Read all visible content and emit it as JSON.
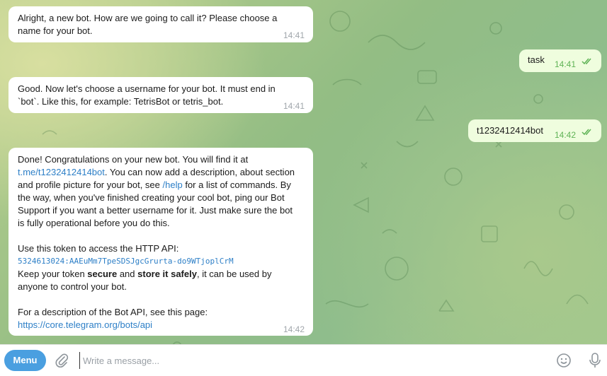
{
  "messages": [
    {
      "direction": "incoming",
      "lines": [
        "Alright, a new bot. How are we going to call it? Please choose a",
        "name for your bot."
      ],
      "time": "14:41"
    },
    {
      "direction": "outgoing",
      "text": "task",
      "time": "14:41",
      "status": "read"
    },
    {
      "direction": "incoming",
      "lines": [
        "Good. Now let's choose a username for your bot. It must end in",
        "`bot`. Like this, for example: TetrisBot or tetris_bot."
      ],
      "time": "14:41"
    },
    {
      "direction": "outgoing",
      "text": "t1232412414bot",
      "time": "14:42",
      "status": "read"
    },
    {
      "direction": "incoming",
      "time": "14:42",
      "parts": {
        "l1": "Done! Congratulations on your new bot. You will find it at",
        "bot_link": "t.me/t1232412414bot",
        "l2_rest": ". You can now add a description, about section",
        "l3_a": "and profile picture for your bot, see ",
        "help_link": "/help",
        "l3_b": " for a list of commands. By",
        "l4": "the way, when you've finished creating your cool bot, ping our Bot",
        "l5": "Support if you want a better username for it. Just make sure the bot",
        "l6": "is fully operational before you do this.",
        "l7": "Use this token to access the HTTP API:",
        "token": "5324613024:AAEuMm7TpeSDSJgcGrurta-do9WTjoplCrM",
        "l8_a": "Keep your token ",
        "l8_bold1": "secure",
        "l8_b": " and ",
        "l8_bold2": "store it safely",
        "l8_c": ", it can be used by",
        "l9": "anyone to control your bot.",
        "l10": "For a description of the Bot API, see this page:",
        "api_link": "https://core.telegram.org/bots/api"
      }
    }
  ],
  "composer": {
    "menu_label": "Menu",
    "placeholder": "Write a message..."
  },
  "icons": {
    "attach": "paperclip-icon",
    "emoji": "emoji-icon",
    "voice": "microphone-icon",
    "read_status": "double-check-icon"
  },
  "colors": {
    "menu_button": "#4a9fe0",
    "outgoing_bubble": "#effdde",
    "link": "#2d7fc7",
    "check": "#5fb355"
  }
}
